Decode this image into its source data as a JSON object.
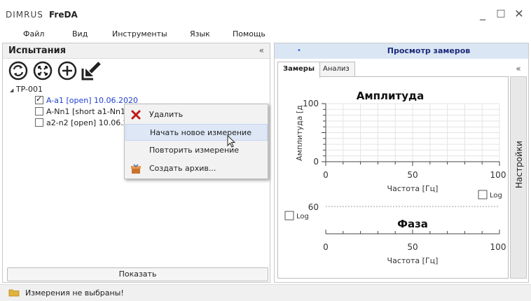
{
  "app": {
    "logo_text": "DIMRUS",
    "name": "FreDA",
    "window_buttons": {
      "minimize": "_",
      "maximize": "□",
      "close": "✕"
    }
  },
  "menu": [
    "Файл",
    "Вид",
    "Инструменты",
    "Язык",
    "Помощь"
  ],
  "left_panel": {
    "title": "Испытания",
    "collapse": "«",
    "toolbar_icons": [
      "refresh-icon",
      "expand-all-icon",
      "add-icon",
      "import-icon"
    ],
    "tree": {
      "root": "TP-001",
      "root_toggle": "◢",
      "items": [
        {
          "label": "A-a1 [open] 10.06.2020",
          "checked": true,
          "color": "#1f3fd0"
        },
        {
          "label": "A-Nn1 [short a1-Nn1]",
          "checked": false,
          "color": "#222222"
        },
        {
          "label": "a2-n2 [open] 10.06.20",
          "checked": false,
          "color": "#222222"
        }
      ]
    },
    "show_button": "Показать"
  },
  "context_menu": {
    "items": [
      {
        "label": "Удалить",
        "icon": "delete-x-icon",
        "highlighted": false
      },
      {
        "label": "Начать новое измерение",
        "icon": "",
        "highlighted": true
      },
      {
        "label": "Повторить измерение",
        "icon": "",
        "highlighted": false
      },
      {
        "label": "Создать архив...",
        "icon": "archive-icon",
        "highlighted": false
      }
    ]
  },
  "right_panel": {
    "title": "Просмотр замеров",
    "dot": "•",
    "tabs": [
      "Замеры",
      "Анализ"
    ],
    "collapse": "«",
    "settings_label": "Настройки"
  },
  "chart_data": [
    {
      "type": "line",
      "title": "Амплитуда",
      "xlabel": "Частота [Гц]",
      "ylabel": "Амплитуда [д",
      "xlim": [
        0,
        100
      ],
      "ylim": [
        0,
        100
      ],
      "xticks": [
        "0",
        "50",
        "100"
      ],
      "yticks": [
        "0",
        "100"
      ],
      "grid": true,
      "series": [],
      "log_checkbox": "Log"
    },
    {
      "type": "line",
      "title": "Фаза",
      "xlabel": "Частота [Гц]",
      "ylabel": "",
      "xlim": [
        0,
        100
      ],
      "xticks": [
        "0",
        "50",
        "100"
      ],
      "yticks": [
        "60"
      ],
      "grid": false,
      "series": [],
      "log_checkbox": "Log"
    }
  ],
  "status": {
    "icon": "folder-icon",
    "text": "Измерения не выбраны!"
  }
}
